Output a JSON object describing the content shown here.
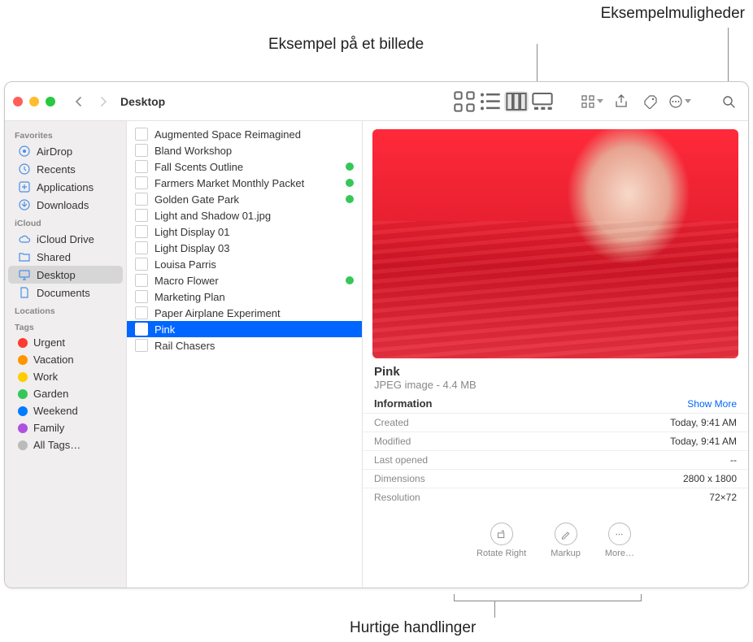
{
  "annotations": {
    "preview_image": "Eksempel på et billede",
    "preview_options": "Eksempelmuligheder",
    "quick_actions": "Hurtige handlinger"
  },
  "toolbar": {
    "location": "Desktop"
  },
  "sidebar": {
    "sections": {
      "favorites": "Favorites",
      "icloud": "iCloud",
      "locations": "Locations",
      "tags": "Tags"
    },
    "favorites": [
      {
        "label": "AirDrop"
      },
      {
        "label": "Recents"
      },
      {
        "label": "Applications"
      },
      {
        "label": "Downloads"
      }
    ],
    "icloud": [
      {
        "label": "iCloud Drive"
      },
      {
        "label": "Shared"
      },
      {
        "label": "Desktop",
        "selected": true
      },
      {
        "label": "Documents"
      }
    ],
    "tags": [
      {
        "label": "Urgent",
        "color": "#ff3b30"
      },
      {
        "label": "Vacation",
        "color": "#ff9500"
      },
      {
        "label": "Work",
        "color": "#ffcc00"
      },
      {
        "label": "Garden",
        "color": "#34c759"
      },
      {
        "label": "Weekend",
        "color": "#007aff"
      },
      {
        "label": "Family",
        "color": "#af52de"
      }
    ],
    "all_tags": "All Tags…"
  },
  "files": [
    {
      "name": "Augmented Space Reimagined"
    },
    {
      "name": "Bland Workshop"
    },
    {
      "name": "Fall Scents Outline",
      "tagged": true
    },
    {
      "name": "Farmers Market Monthly Packet",
      "tagged": true
    },
    {
      "name": "Golden Gate Park",
      "tagged": true
    },
    {
      "name": "Light and Shadow 01.jpg"
    },
    {
      "name": "Light Display 01"
    },
    {
      "name": "Light Display 03"
    },
    {
      "name": "Louisa Parris"
    },
    {
      "name": "Macro Flower",
      "tagged": true
    },
    {
      "name": "Marketing Plan"
    },
    {
      "name": "Paper Airplane Experiment"
    },
    {
      "name": "Pink",
      "selected": true
    },
    {
      "name": "Rail Chasers"
    }
  ],
  "preview": {
    "title": "Pink",
    "subtitle": "JPEG image - 4.4 MB",
    "info_header": "Information",
    "show_more": "Show More",
    "rows": [
      {
        "label": "Created",
        "value": "Today, 9:41 AM"
      },
      {
        "label": "Modified",
        "value": "Today, 9:41 AM"
      },
      {
        "label": "Last opened",
        "value": "--"
      },
      {
        "label": "Dimensions",
        "value": "2800 x 1800"
      },
      {
        "label": "Resolution",
        "value": "72×72"
      }
    ],
    "actions": [
      {
        "label": "Rotate Right"
      },
      {
        "label": "Markup"
      },
      {
        "label": "More…"
      }
    ]
  }
}
